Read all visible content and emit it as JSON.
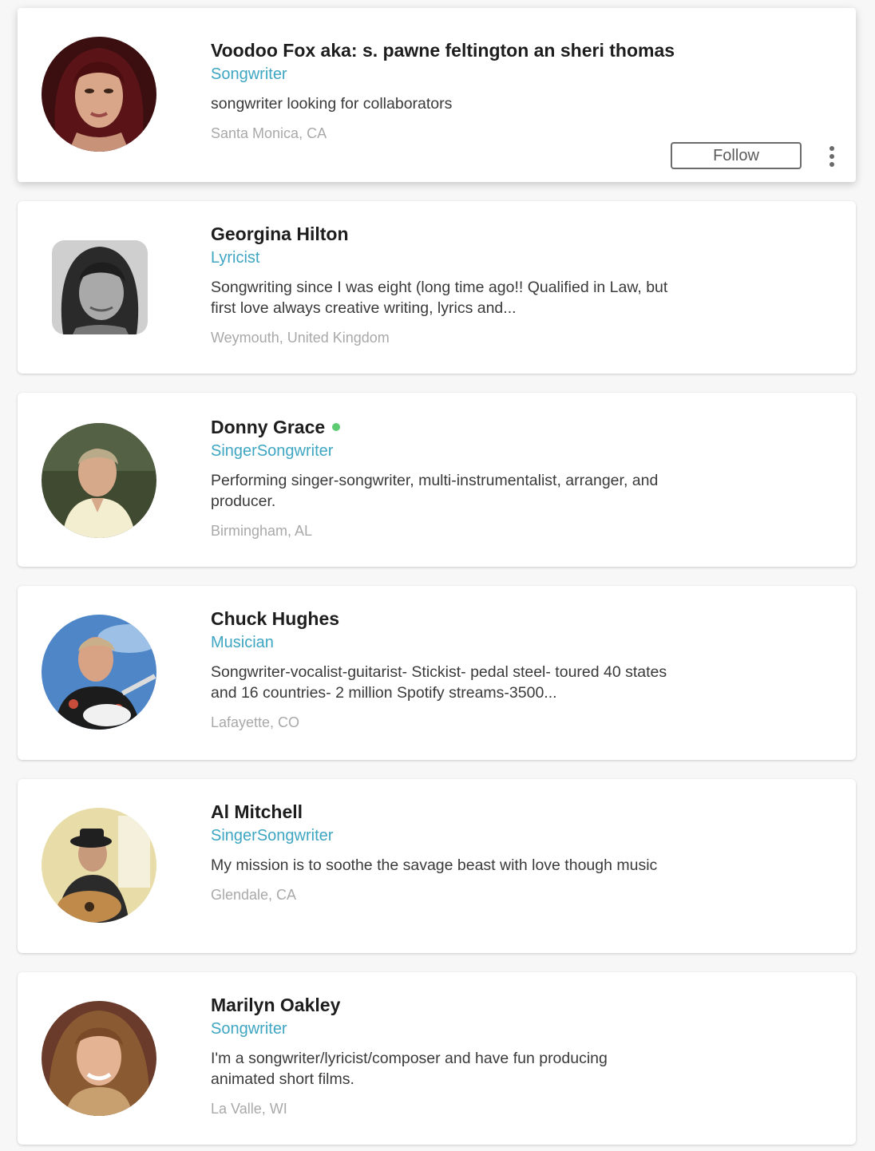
{
  "profiles": [
    {
      "name": "Voodoo Fox aka: s. pawne feltington an sheri thomas",
      "role": "Songwriter",
      "bio": "songwriter looking for collaborators",
      "location": "Santa Monica, CA",
      "online": false,
      "follow_label": "Follow",
      "avatar": "avatar-icon"
    },
    {
      "name": "Georgina Hilton",
      "role": "Lyricist",
      "bio": "Songwriting since I was eight (long time ago!! Qualified in Law, but first love always creative writing, lyrics and...",
      "location": "Weymouth, United Kingdom",
      "online": false,
      "avatar": "avatar-icon"
    },
    {
      "name": "Donny Grace",
      "role": "SingerSongwriter",
      "bio": "Performing singer-songwriter, multi-instrumentalist, arranger, and producer.",
      "location": "Birmingham, AL",
      "online": true,
      "avatar": "avatar-icon"
    },
    {
      "name": "Chuck Hughes",
      "role": "Musician",
      "bio": "Songwriter-vocalist-guitarist- Stickist- pedal steel- toured 40 states and 16 countries- 2 million Spotify streams-3500...",
      "location": "Lafayette, CO",
      "online": false,
      "avatar": "avatar-icon"
    },
    {
      "name": "Al Mitchell",
      "role": "SingerSongwriter",
      "bio": "My mission is to soothe the savage beast with love though music",
      "location": "Glendale, CA",
      "online": false,
      "avatar": "avatar-icon"
    },
    {
      "name": "Marilyn Oakley",
      "role": "Songwriter",
      "bio": "I'm a songwriter/lyricist/composer and have fun producing animated short films.",
      "location": "La Valle, WI",
      "online": false,
      "avatar": "avatar-icon"
    }
  ],
  "colors": {
    "role": "#3ea6c2",
    "online": "#5ccb72",
    "location": "#a9a9a9"
  }
}
